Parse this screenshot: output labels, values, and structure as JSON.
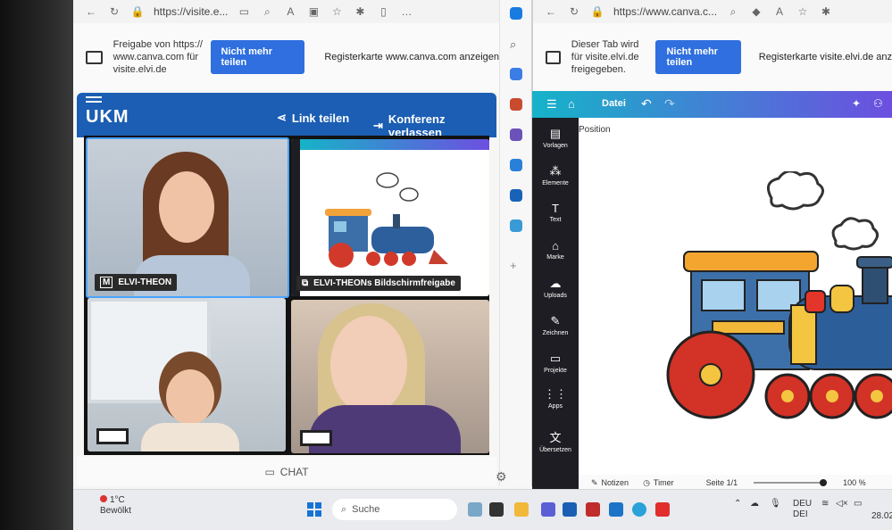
{
  "left_browser": {
    "url": "https://visite.e...",
    "share_text": "Freigabe von https:// www.canva.com für visite.elvi.de",
    "stop_button": "Nicht mehr teilen",
    "show_tab": "Registerkarte www.canva.com anzeigen"
  },
  "right_browser": {
    "url": "https://www.canva.c...",
    "share_text": "Dieser Tab wird für visite.elvi.de freigegeben.",
    "stop_button": "Nicht mehr teilen",
    "show_tab": "Registerkarte visite.elvi.de anz"
  },
  "ukm": {
    "logo": "UKM",
    "link_share": "Link teilen",
    "leave": "Konferenz verlassen",
    "participants": [
      {
        "name": "ELVI-THEON",
        "badge": "M"
      },
      {
        "name": "ELVI-THEONs Bildschirmfreigabe"
      }
    ],
    "chat": "CHAT"
  },
  "canva": {
    "menu": "Datei",
    "position": "Position",
    "sidebar": [
      "Vorlagen",
      "Elemente",
      "Text",
      "Marke",
      "Uploads",
      "Zeichnen",
      "Projekte",
      "Apps",
      "Übersetzen"
    ],
    "notes": "Notizen",
    "timer": "Timer",
    "page": "Seite 1/1",
    "zoom": "100 %"
  },
  "taskbar": {
    "temp": "1°C",
    "weather": "Bewölkt",
    "search": "Suche",
    "lang1": "DEU",
    "lang2": "DEI",
    "date": "28.02"
  }
}
